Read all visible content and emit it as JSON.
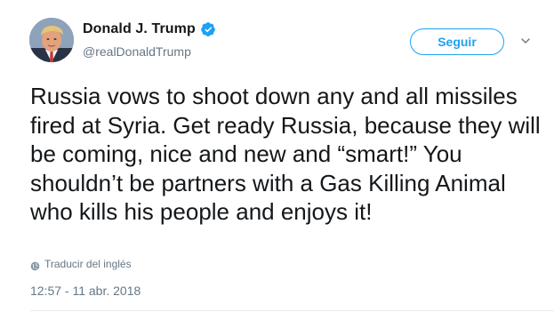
{
  "user": {
    "display_name": "Donald J. Trump",
    "handle": "@realDonaldTrump",
    "verified": true
  },
  "actions": {
    "follow_label": "Seguir"
  },
  "tweet": {
    "text": "Russia vows to shoot down any and all missiles fired at Syria. Get ready Russia, because they will be coming, nice and new and “smart!” You shouldn’t be partners with a Gas Killing Animal who kills his people and enjoys it!",
    "translate_label": "Traducir del inglés",
    "timestamp": "12:57 - 11 abr. 2018"
  },
  "colors": {
    "accent": "#1da1f2",
    "text": "#14171a",
    "muted": "#657786"
  },
  "icons": [
    "verified-badge-icon",
    "chevron-down-icon",
    "globe-icon"
  ]
}
